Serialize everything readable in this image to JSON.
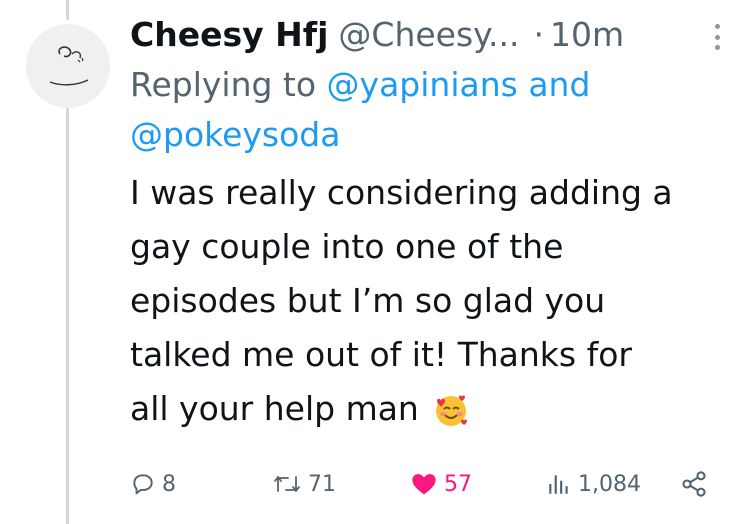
{
  "tweet": {
    "display_name": "Cheesy Hfj",
    "handle": "@Cheesy...",
    "separator": "·",
    "time": "10m",
    "replying_prefix": "Replying to",
    "mention_1": "@yapinians",
    "replying_and": "and",
    "mention_2": "@pokeysoda",
    "body_line_1": "I was really considering adding a",
    "body_line_2": "gay couple into one of the",
    "body_line_3": "episodes but I’m so glad you",
    "body_line_4": "talked me out of it! Thanks for",
    "body_line_5": "all your help man",
    "emoji_icon": "smiling-face-with-hearts-icon"
  },
  "actions": {
    "replies": "8",
    "retweets": "71",
    "likes": "57",
    "views": "1,084"
  },
  "colors": {
    "link": "#1d9bf0",
    "secondary_text": "#536471",
    "like": "#f91880"
  }
}
